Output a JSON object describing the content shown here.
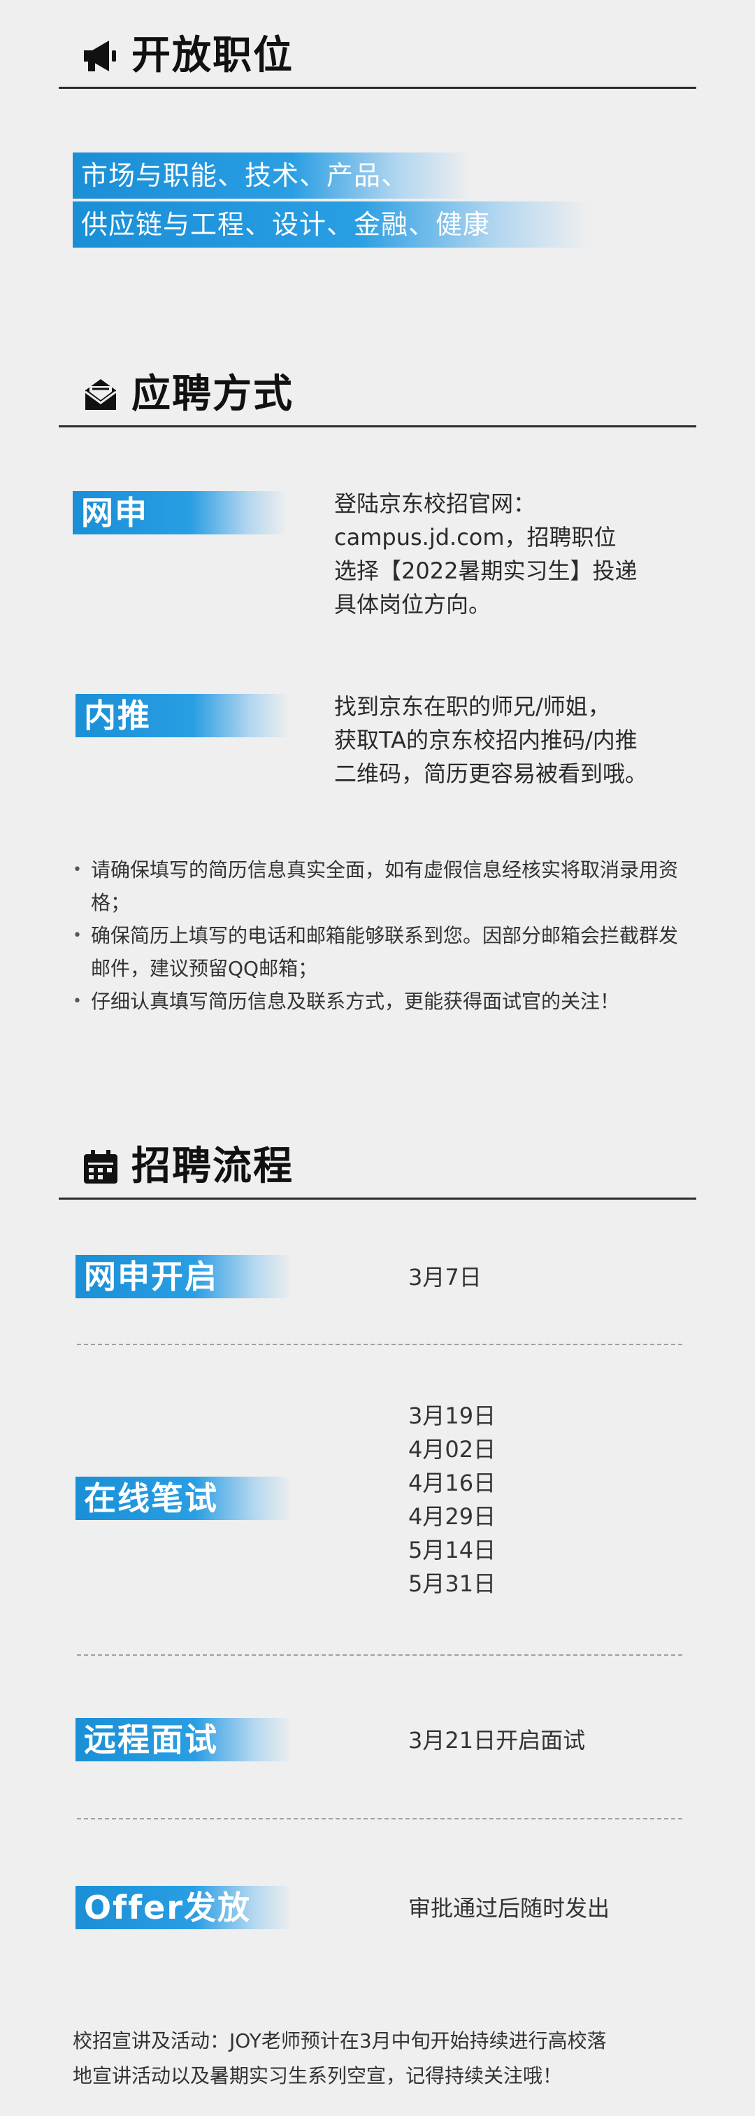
{
  "sections": {
    "positions": {
      "title": "开放职位",
      "icon": "megaphone-icon"
    },
    "apply": {
      "title": "应聘方式",
      "icon": "envelope-icon"
    },
    "process": {
      "title": "招聘流程",
      "icon": "calendar-icon"
    }
  },
  "positions": {
    "line1": "市场与职能、技术、产品、",
    "line2": "供应链与工程、设计、金融、健康"
  },
  "apply": {
    "online": {
      "label": "网申",
      "text": [
        "登陆京东校招官网：",
        "campus.jd.com，招聘职位",
        "选择【2022暑期实习生】投递",
        "具体岗位方向。"
      ]
    },
    "referral": {
      "label": "内推",
      "text": [
        "找到京东在职的师兄/师姐，",
        "获取TA的京东校招内推码/内推",
        "二维码，简历更容易被看到哦。"
      ]
    },
    "notes": [
      "请确保填写的简历信息真实全面，如有虚假信息经核实将取消录用资格；",
      "确保简历上填写的电话和邮箱能够联系到您。因部分邮箱会拦截群发邮件，建议预留QQ邮箱；",
      "仔细认真填写简历信息及联系方式，更能获得面试官的关注！"
    ]
  },
  "process": {
    "stage1": {
      "label": "网申开启",
      "dates": [
        "3月7日"
      ]
    },
    "stage2": {
      "label": "在线笔试",
      "dates": [
        "3月19日",
        "4月02日",
        "4月16日",
        "4月29日",
        "5月14日",
        "5月31日"
      ]
    },
    "stage3": {
      "label": "远程面试",
      "dates": [
        "3月21日开启面试"
      ]
    },
    "stage4": {
      "label": "Offer发放",
      "dates": [
        "审批通过后随时发出"
      ]
    }
  },
  "footer": {
    "line1": "校招宣讲及活动：JOY老师预计在3月中旬开始持续进行高校落",
    "line2": "地宣讲活动以及暑期实习生系列空宣，记得持续关注哦！"
  },
  "colors": {
    "accent": "#1b8fd6",
    "text": "#222222",
    "background": "#efefef"
  }
}
